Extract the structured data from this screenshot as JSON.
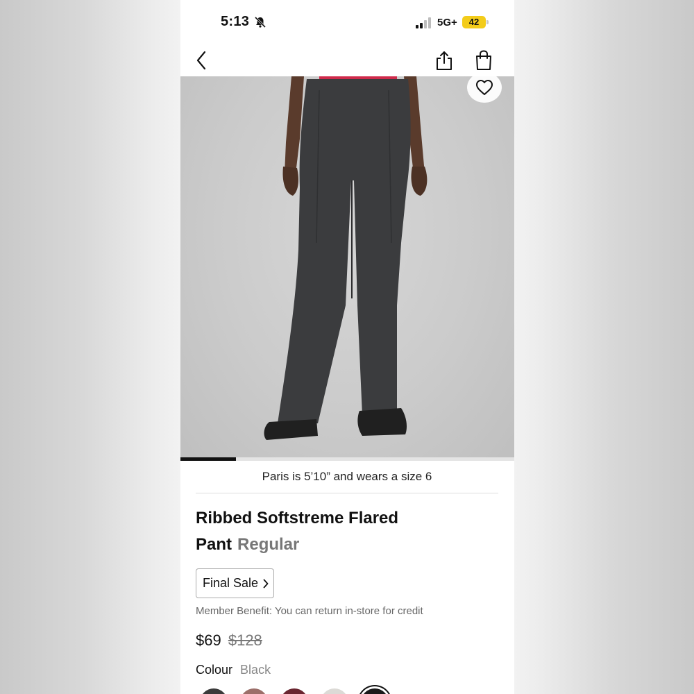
{
  "status_bar": {
    "time": "5:13",
    "network": "5G+",
    "battery": "42"
  },
  "nav": {
    "back": "chevron-left-icon",
    "share": "share-icon",
    "bag": "shopping-bag-icon"
  },
  "gallery": {
    "wishlist_icon": "heart-icon",
    "position_fraction": 0.167
  },
  "model_info": "Paris is 5’10” and wears a size 6",
  "product": {
    "name": "Ribbed Softstreme Flared Pant",
    "fit": "Regular",
    "final_sale_label": "Final Sale",
    "member_benefit": "Member Benefit: You can return in-store for credit",
    "price": "$69",
    "original_price": "$128",
    "colour_label": "Colour",
    "colour_value": "Black",
    "swatches": [
      {
        "color": "#3b3b3b",
        "selected": false
      },
      {
        "color": "#9c6f6a",
        "selected": false
      },
      {
        "color": "#6a2530",
        "selected": false
      },
      {
        "color": "#dcdad6",
        "selected": false
      },
      {
        "color": "#1a1a1a",
        "selected": true
      }
    ]
  },
  "colors": {
    "accent": "#111111",
    "battery": "#f3cc1a",
    "muted_text": "#777777"
  }
}
